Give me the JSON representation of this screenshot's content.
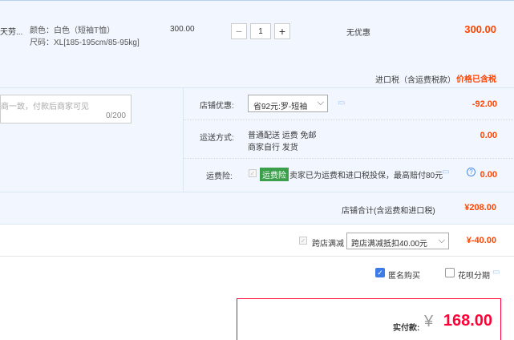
{
  "item": {
    "title": "天劳...",
    "attrs": [
      "颜色：白色（短袖T恤）",
      "尺码：XL[185-195cm/85-95kg]"
    ],
    "price": "300.00",
    "quantity": "1",
    "minus": "−",
    "plus": "+",
    "discount": "无优惠",
    "total": "300.00",
    "tax_label": "进口税（含运费税款）",
    "tax_value": "价格已含税"
  },
  "message": {
    "placeholder": "商一致，付款后商家可见",
    "counter": "0/200"
  },
  "shop_discount": {
    "label": "店铺优惠:",
    "selected": "省92元:罗-短袖",
    "value": "-92.00"
  },
  "shipping": {
    "label": "运送方式:",
    "line1": "普通配送 运费 免邮",
    "line2": "商家自行  发货",
    "value": "0.00"
  },
  "insurance": {
    "label": "运费险:",
    "tag": "运费险",
    "text": "卖家已为运费和进口税投保，最高赔付80元",
    "value": "0.00"
  },
  "shop_total": {
    "label": "店铺合计(含运费和进口税)",
    "value": "¥208.00"
  },
  "cross_shop": {
    "label": "跨店满减",
    "selected": "跨店满减抵扣40.00元",
    "value": "¥-40.00"
  },
  "options": {
    "anonymous": "匿名购买",
    "installment": "花呗分期"
  },
  "payment": {
    "label": "实付款:",
    "currency": "¥",
    "amount": "168.00"
  },
  "colors": {
    "accent": "#ff4400",
    "pay_red": "#ff0036",
    "panel_bg": "#f2f7ff",
    "check_blue": "#3d7be6"
  }
}
